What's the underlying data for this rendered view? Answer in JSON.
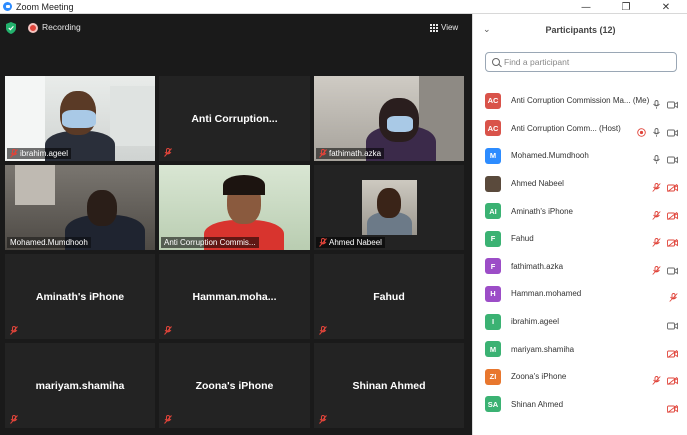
{
  "window": {
    "title": "Zoom Meeting",
    "minimize": "—",
    "restore": "❐",
    "close": "✕"
  },
  "topbar": {
    "recording_label": "Recording",
    "view_label": "View"
  },
  "tiles": [
    {
      "name": "ibrahim.ageel",
      "video": true
    },
    {
      "name": "Anti  Corruption...",
      "video": false
    },
    {
      "name": "fathimath.azka",
      "video": true
    },
    {
      "name": "Mohamed.Mumdhooh",
      "video": true
    },
    {
      "name": "Anti Corruption Commis...",
      "video": true,
      "active": true
    },
    {
      "name": "Ahmed Nabeel",
      "video": true
    },
    {
      "name": "Aminath's iPhone",
      "video": false
    },
    {
      "name": "Hamman.moha...",
      "video": false
    },
    {
      "name": "Fahud",
      "video": false
    },
    {
      "name": "mariyam.shamiha",
      "video": false
    },
    {
      "name": "Zoona's iPhone",
      "video": false
    },
    {
      "name": "Shinan Ahmed",
      "video": false
    }
  ],
  "panel": {
    "title": "Participants (12)",
    "search_placeholder": "Find a participant",
    "participants": [
      {
        "initials": "AC",
        "color": "#d9534a",
        "name": "Anti Corruption Commission Ma... (Me)",
        "icons": [
          "mic-icon",
          "video-icon"
        ]
      },
      {
        "initials": "AC",
        "color": "#d9534a",
        "name": "Anti Corruption Comm... (Host)",
        "icons": [
          "record-icon",
          "mic-icon",
          "video-icon"
        ]
      },
      {
        "initials": "M",
        "color": "#2d8cff",
        "name": "Mohamed.Mumdhooh",
        "icons": [
          "mic-icon",
          "video-icon"
        ]
      },
      {
        "initials": "",
        "color": "#5a4a3c",
        "name": "Ahmed Nabeel",
        "icons": [
          "mic-muted-icon",
          "video-off-icon"
        ]
      },
      {
        "initials": "AI",
        "color": "#3bb273",
        "name": "Aminath's iPhone",
        "icons": [
          "mic-muted-icon",
          "video-off-icon"
        ]
      },
      {
        "initials": "F",
        "color": "#3bb273",
        "name": "Fahud",
        "icons": [
          "mic-muted-icon",
          "video-off-icon"
        ]
      },
      {
        "initials": "F",
        "color": "#9c4dc7",
        "name": "fathimath.azka",
        "icons": [
          "mic-muted-icon",
          "video-icon"
        ]
      },
      {
        "initials": "H",
        "color": "#9c4dc7",
        "name": "Hamman.mohamed",
        "icons": [
          "mic-muted-icon"
        ]
      },
      {
        "initials": "I",
        "color": "#3bb273",
        "name": "ibrahim.ageel",
        "icons": [
          "video-icon"
        ]
      },
      {
        "initials": "M",
        "color": "#3bb273",
        "name": "mariyam.shamiha",
        "icons": [
          "video-off-icon"
        ]
      },
      {
        "initials": "ZI",
        "color": "#e8772e",
        "name": "Zoona's iPhone",
        "icons": [
          "mic-muted-icon",
          "video-off-icon"
        ]
      },
      {
        "initials": "SA",
        "color": "#3bb273",
        "name": "Shinan Ahmed",
        "icons": [
          "video-off-icon"
        ]
      }
    ]
  }
}
